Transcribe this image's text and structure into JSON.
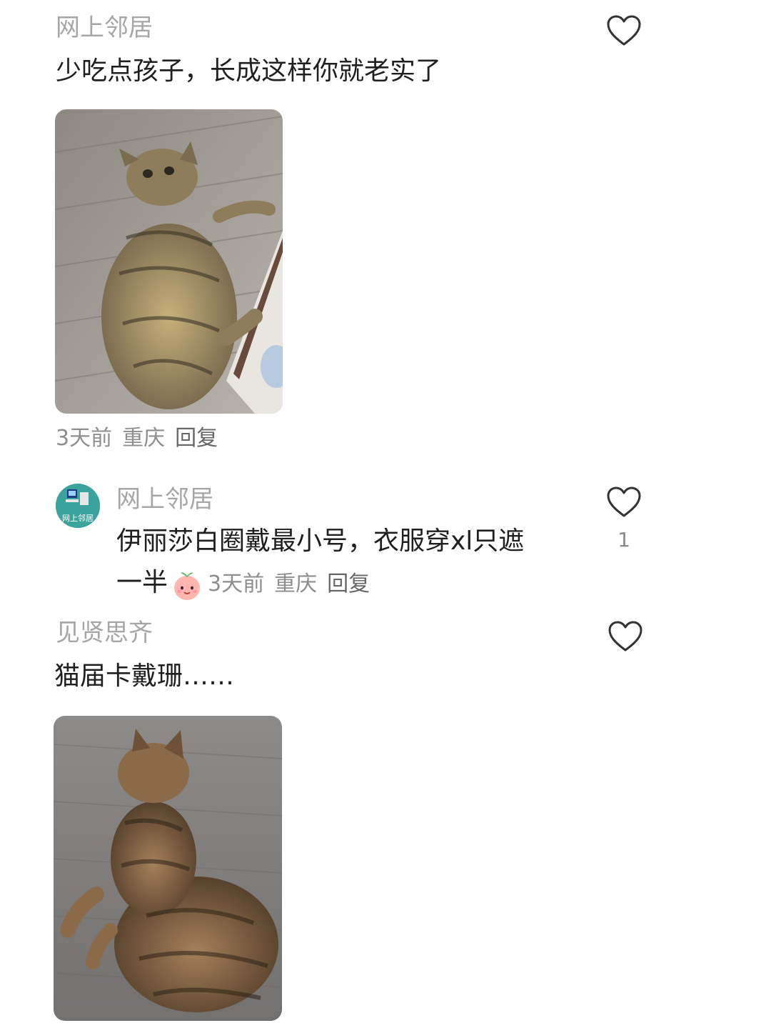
{
  "comments": [
    {
      "username": "网上邻居",
      "text": "少吃点孩子，长成这样你就老实了",
      "image_alt": "fat-tabby-cat-photo",
      "meta": {
        "time": "3天前",
        "location": "重庆",
        "reply": "回复"
      },
      "like_icon": "heart-outline-icon"
    },
    {
      "username": "网上邻居",
      "avatar_text": "网上邻居",
      "text_line1": "伊丽莎白圈戴最小号，衣服穿xl只遮",
      "text_line2": "一半",
      "emoji": "peach-face-emoji",
      "meta": {
        "time": "3天前",
        "location": "重庆",
        "reply": "回复"
      },
      "like_icon": "heart-outline-icon",
      "like_count": "1"
    },
    {
      "username": "见贤思齐",
      "text": "猫届卡戴珊……",
      "image_alt": "tabby-cat-sitting-photo",
      "like_icon": "heart-outline-icon"
    }
  ],
  "colors": {
    "username": "#a6a6a6",
    "text": "#1f1f1f",
    "meta": "#8e8e8e",
    "avatar_bg": "#3aa39b"
  }
}
